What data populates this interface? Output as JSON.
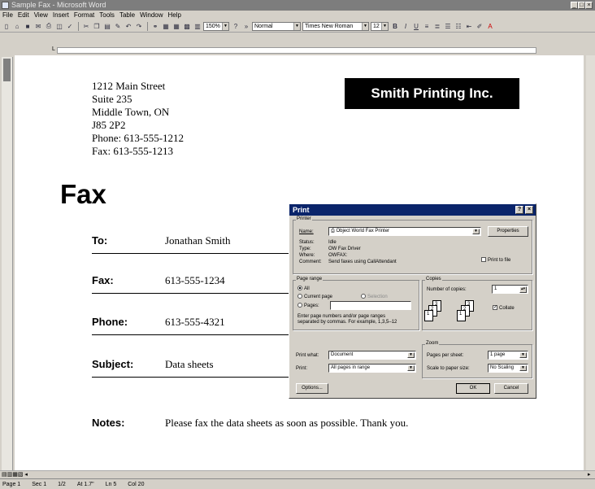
{
  "window": {
    "title": "Sample Fax - Microsoft Word"
  },
  "menu": [
    "File",
    "Edit",
    "View",
    "Insert",
    "Format",
    "Tools",
    "Table",
    "Window",
    "Help"
  ],
  "toolbar": {
    "zoom": "150%",
    "style": "Normal",
    "font": "Times New Roman",
    "size": "12"
  },
  "document": {
    "address": [
      "1212 Main Street",
      "Suite 235",
      "Middle Town, ON",
      "J85 2P2",
      "Phone: 613-555-1212",
      "Fax: 613-555-1213"
    ],
    "company": "Smith Printing Inc.",
    "heading": "Fax",
    "fields": [
      {
        "label": "To:",
        "value": "Jonathan Smith"
      },
      {
        "label": "Fax:",
        "value": "613-555-1234"
      },
      {
        "label": "Phone:",
        "value": "613-555-4321"
      },
      {
        "label": "Subject:",
        "value": "Data sheets"
      },
      {
        "label": "Notes:",
        "value": "Please fax the data sheets as soon as possible. Thank you."
      }
    ]
  },
  "dialog": {
    "title": "Print",
    "printer_group": "Printer",
    "name_label": "Name:",
    "name_value": "Object World Fax Printer",
    "properties_button": "Properties",
    "status_label": "Status:",
    "status_value": "Idle",
    "type_label": "Type:",
    "type_value": "OW Fax Driver",
    "where_label": "Where:",
    "where_value": "OWFAX:",
    "comment_label": "Comment:",
    "comment_value": "Send faxes using CallAttendant",
    "print_to_file": "Print to file",
    "page_range_group": "Page range",
    "all": "All",
    "current_page": "Current page",
    "selection": "Selection",
    "pages": "Pages:",
    "range_hint_1": "Enter page numbers and/or page ranges",
    "range_hint_2": "separated by commas.  For example, 1,3,5–12",
    "copies_group": "Copies",
    "number_of_copies": "Number of copies:",
    "copies_value": "1",
    "collate": "Collate",
    "print_what_label": "Print what:",
    "print_what_value": "Document",
    "print_label": "Print:",
    "print_value": "All pages in range",
    "zoom_group": "Zoom",
    "pages_per_sheet_label": "Pages per sheet:",
    "pages_per_sheet_value": "1 page",
    "scale_label": "Scale to paper size:",
    "scale_value": "No Scaling",
    "options_button": "Options...",
    "ok_button": "OK",
    "cancel_button": "Cancel"
  },
  "status": {
    "page": "Page 1",
    "sec": "Sec 1",
    "position": "1/2",
    "at": "At 1.7\"",
    "ln": "Ln 5",
    "col": "Col 20"
  }
}
